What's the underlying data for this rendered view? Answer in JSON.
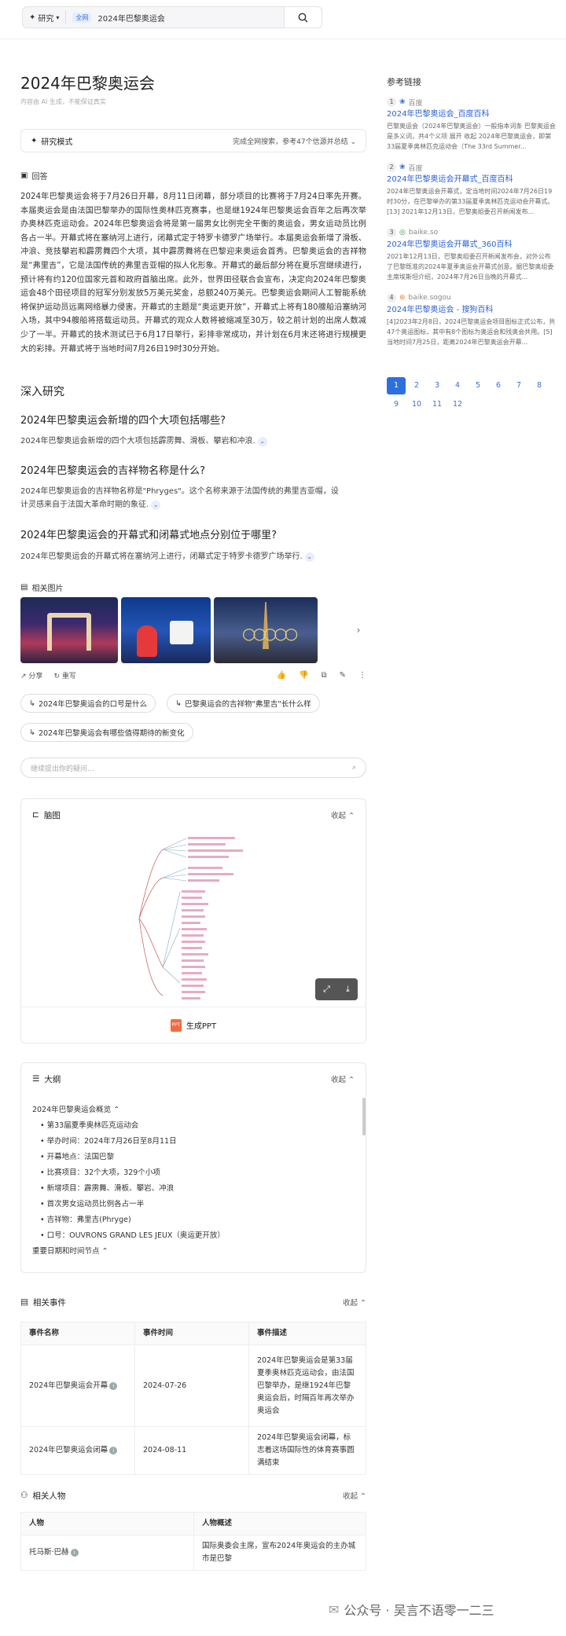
{
  "search": {
    "mode": "研究",
    "scope": "全网",
    "query": "2024年巴黎奥运会"
  },
  "page_title": "2024年巴黎奥运会",
  "disclaimer": "内容由 AI 生成，不能保证真实",
  "research_mode": {
    "label": "研究模式",
    "status": "完成全网搜索，参考47个信源并总结"
  },
  "answer": {
    "label": "回答",
    "text": "2024年巴黎奥运会将于7月26日开幕，8月11日闭幕，部分项目的比赛将于7月24日率先开赛。本届奥运会是由法国巴黎举办的国际性奥林匹克赛事，也是继1924年巴黎奥运会百年之后再次举办奥林匹克运动会。2024年巴黎奥运会将是第一届男女比例完全平衡的奥运会，男女运动员比例各占一半。开幕式将在塞纳河上进行，闭幕式定于特罗卡德罗广场举行。本届奥运会新增了滑板、冲浪、竞技攀岩和霹雳舞四个大项，其中霹雳舞将在巴黎迎来奥运会首秀。巴黎奥运会的吉祥物是“弗里吉”，它是法国传统的弗里吉亚帽的拟人化形象。开幕式的最后部分将在夏乐宫继续进行，预计将有约120位国家元首和政府首脑出席。此外，世界田径联合会宣布，决定向2024年巴黎奥运会48个田径项目的冠军分别发放5万美元奖金，总额240万美元。巴黎奥运会期间人工智能系统将保护运动员远离网络暴力侵害。开幕式的主题是“奥运更开放”，开幕式上将有180艘船沿塞纳河入场，其中94艘船将搭载运动员。开幕式的观众人数将被缩减至30万，较之前计划的出席人数减少了一半。开幕式的技术测试已于6月17日举行，彩排非常成功，并计划在6月末还将进行规模更大的彩排。开幕式将于当地时间7月26日19时30分开始。"
  },
  "deep": {
    "heading": "深入研究",
    "items": [
      {
        "q": "2024年巴黎奥运会新增的四个大项包括哪些?",
        "a": "2024年巴黎奥运会新增的四个大项包括霹雳舞、滑板、攀岩和冲浪."
      },
      {
        "q": "2024年巴黎奥运会的吉祥物名称是什么?",
        "a1": "2024年巴黎奥运会的吉祥物名称是\"Phryges\"。这个名称来源于法国传统的弗里吉亚帽，设",
        "a2": "计灵感来自于法国大革命时期的象征."
      },
      {
        "q": "2024年巴黎奥运会的开幕式和闭幕式地点分别位于哪里?",
        "a": "2024年巴黎奥运会的开幕式将在塞纳河上进行，闭幕式定于特罗卡德罗广场举行."
      }
    ]
  },
  "images_label": "相关图片",
  "actions": {
    "share": "分享",
    "rewrite": "重写"
  },
  "chips": [
    "2024年巴黎奥运会的口号是什么",
    "巴黎奥运会的吉祥物\"弗里吉\"长什么样",
    "2024年巴黎奥运会有哪些值得期待的新变化"
  ],
  "follow_placeholder": "继续提出你的疑问...",
  "mindmap": {
    "label": "脑图",
    "collapse": "收起",
    "ppt": "生成PPT"
  },
  "outline": {
    "label": "大纲",
    "collapse": "收起",
    "section1": "2024年巴黎奥运会概览",
    "items": [
      "第33届夏季奥林匹克运动会",
      "举办时间：2024年7月26日至8月11日",
      "开幕地点：法国巴黎",
      "比赛项目：32个大项，329个小项",
      "新增项目：霹雳舞、滑板、攀岩、冲浪",
      "首次男女运动员比例各占一半",
      "吉祥物：弗里吉(Phryge)",
      "口号：OUVRONS GRAND LES JEUX（奥运更开放）"
    ],
    "section2": "重要日期和时间节点"
  },
  "events": {
    "label": "相关事件",
    "collapse": "收起",
    "headers": [
      "事件名称",
      "事件时间",
      "事件描述"
    ],
    "rows": [
      {
        "name": "2024年巴黎奥运会开幕",
        "time": "2024-07-26",
        "desc": "2024年巴黎奥运会是第33届夏季奥林匹克运动会，由法国巴黎举办，是继1924年巴黎奥运会后，时隔百年再次举办奥运会"
      },
      {
        "name": "2024年巴黎奥运会闭幕",
        "time": "2024-08-11",
        "desc": "2024年巴黎奥运会闭幕，标志着这场国际性的体育赛事圆满结束"
      }
    ]
  },
  "people": {
    "label": "相关人物",
    "collapse": "收起",
    "headers": [
      "人物",
      "人物概述"
    ],
    "rows": [
      {
        "name": "托马斯·巴赫",
        "desc": "国际奥委会主席，宣布2024年奥运会的主办城市是巴黎"
      }
    ]
  },
  "refs": {
    "label": "参考链接",
    "items": [
      {
        "num": "1",
        "src": "百度",
        "title": "2024年巴黎奥运会_百度百科",
        "desc": "巴黎奥运会（2024年巴黎奥运会）一般指本词条 巴黎奥运会是多义词，共4个义项 展开 收起 2024年巴黎奥运会，即第33届夏季奥林匹克运动会（The 33rd Summer..."
      },
      {
        "num": "2",
        "src": "百度",
        "title": "2024年巴黎奥运会开幕式_百度百科",
        "desc": "2024年巴黎奥运会开幕式，定当地时间2024年7月26日19时30分，在巴黎举办的第33届夏季奥林匹克运动会开幕式。[13] 2021年12月13日，巴黎奥组委召开新闻发布..."
      },
      {
        "num": "3",
        "src": "baike.so",
        "title": "2024年巴黎奥运会开幕式_360百科",
        "desc": "2021年12月13日，巴黎奥组委召开新闻发布会，对外公布了巴黎既准的2024年夏季奥运会开幕式创意。据巴黎奥组委主席埃斯坦介绍，2024年7月26日当晚的开幕式..."
      },
      {
        "num": "4",
        "src": "baike.sogou",
        "title": "2024年巴黎奥运会 - 搜狗百科",
        "desc": "[4]2023年2月8日，2024巴黎奥运会项目图标正式公布，共47个奥运图标，其中有8个图标为奥运会和残奥会共用。[5]当地时间7月25日，距离2024年巴黎奥运会开幕..."
      }
    ],
    "pages": [
      "1",
      "2",
      "3",
      "4",
      "5",
      "6",
      "7",
      "8",
      "9",
      "10",
      "11",
      "12"
    ]
  },
  "watermark": "公众号 · 吴言不语零一二三"
}
